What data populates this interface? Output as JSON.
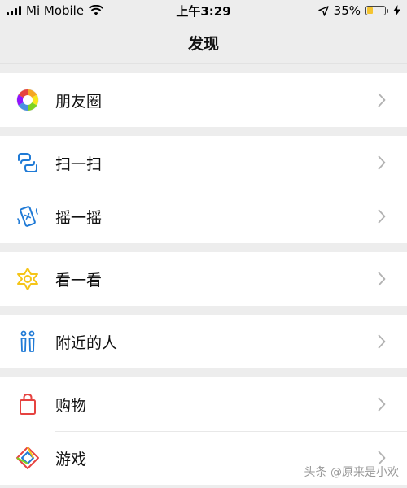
{
  "status_bar": {
    "carrier": "Mi Mobile",
    "time": "上午3:29",
    "battery_percent": "35%",
    "battery_level": 0.35
  },
  "nav": {
    "title": "发现"
  },
  "groups": [
    [
      {
        "label": "朋友圈",
        "icon": "moments-aperture-icon"
      }
    ],
    [
      {
        "label": "扫一扫",
        "icon": "scan-icon"
      },
      {
        "label": "摇一摇",
        "icon": "shake-phone-icon"
      }
    ],
    [
      {
        "label": "看一看",
        "icon": "top-stories-icon"
      }
    ],
    [
      {
        "label": "附近的人",
        "icon": "people-nearby-icon"
      }
    ],
    [
      {
        "label": "购物",
        "icon": "shopping-bag-icon"
      },
      {
        "label": "游戏",
        "icon": "games-diamond-icon"
      }
    ]
  ],
  "colors": {
    "background": "#ededed",
    "scan_blue": "#1f7ad6",
    "stories_yellow": "#f5c518",
    "shop_red": "#e64340"
  },
  "watermark": "头条 @原来是小欢"
}
